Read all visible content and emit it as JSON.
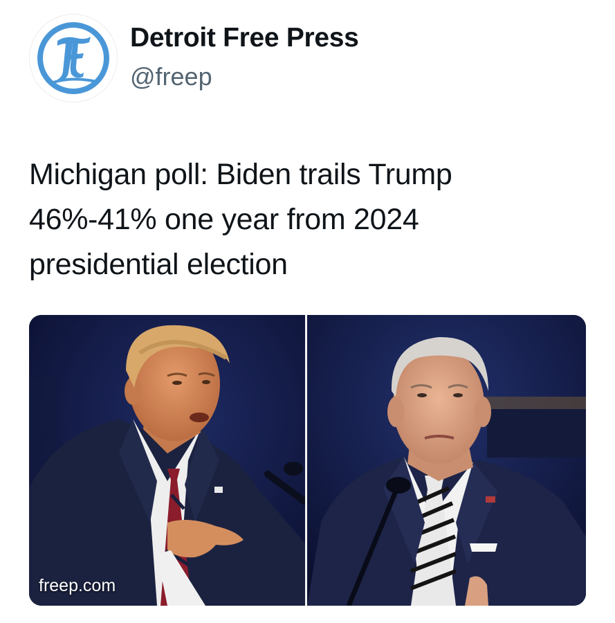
{
  "account": {
    "display_name": "Detroit Free Press",
    "handle": "@freep",
    "avatar_icon": "freep-logo-icon",
    "avatar_color": "#4a97d8"
  },
  "tweet": {
    "headline_lines": [
      "Michigan poll: Biden trails Trump",
      "46%-41% one year from 2024",
      "presidential election"
    ]
  },
  "link_card": {
    "domain": "freep.com",
    "left_photo_icon": "candidate-photo-left",
    "right_photo_icon": "candidate-photo-right"
  }
}
